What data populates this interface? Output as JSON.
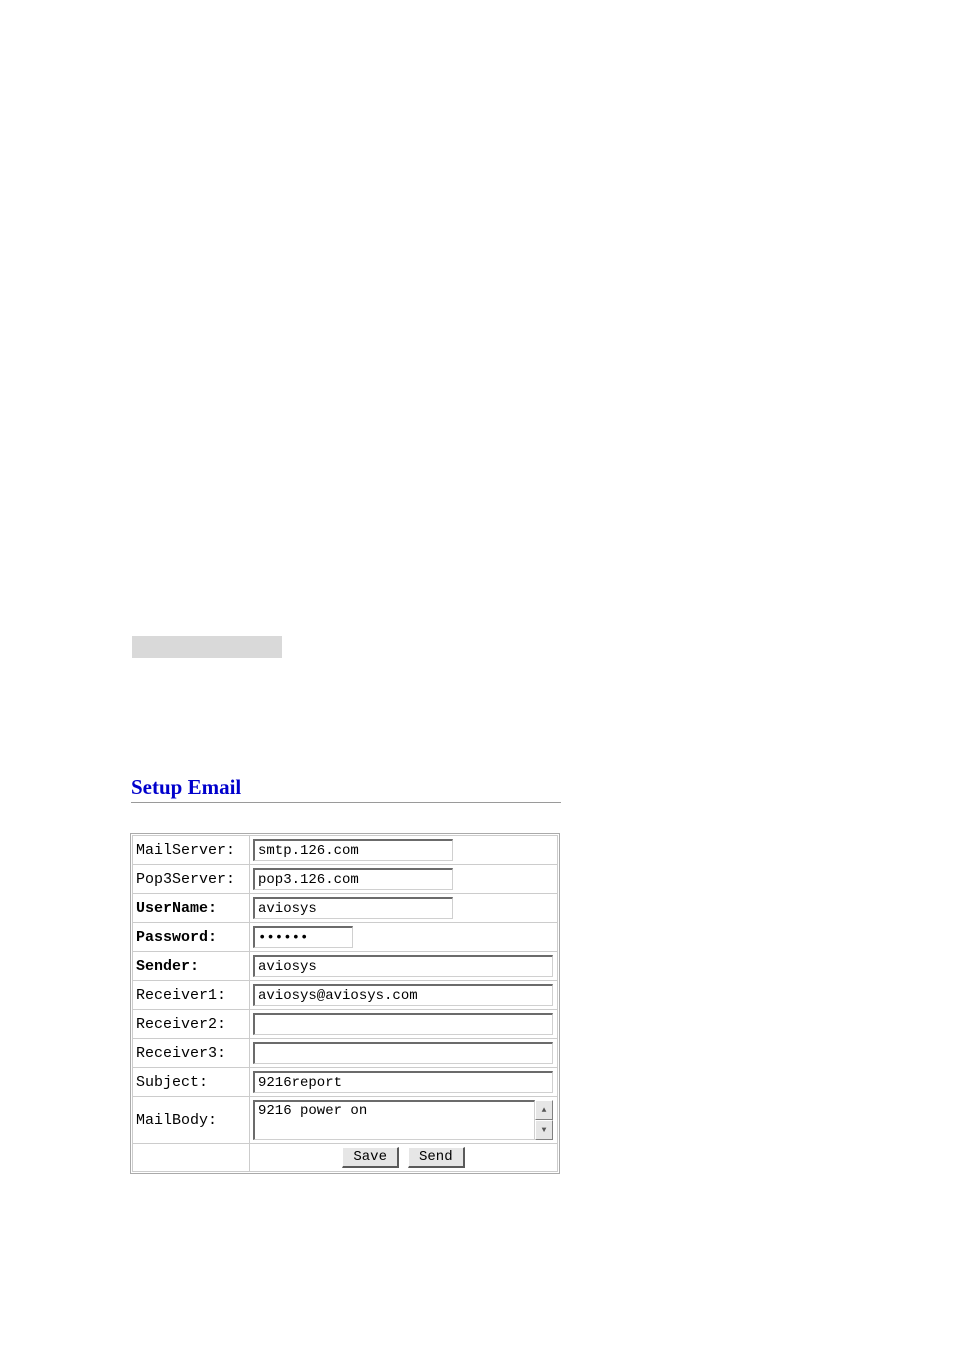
{
  "section_title": "Setup Email",
  "labels": {
    "mailserver": "MailServer:",
    "pop3server": "Pop3Server:",
    "username": "UserName:",
    "password": "Password:",
    "sender": "Sender:",
    "receiver1": "Receiver1:",
    "receiver2": "Receiver2:",
    "receiver3": "Receiver3:",
    "subject": "Subject:",
    "mailbody": "MailBody:"
  },
  "values": {
    "mailserver": "smtp.126.com",
    "pop3server": "pop3.126.com",
    "username": "aviosys",
    "password": "••••••",
    "sender": "aviosys",
    "receiver1": "aviosys@aviosys.com",
    "receiver2": "",
    "receiver3": "",
    "subject": "9216report",
    "mailbody": "9216 power on"
  },
  "buttons": {
    "save": "Save",
    "send": "Send"
  }
}
